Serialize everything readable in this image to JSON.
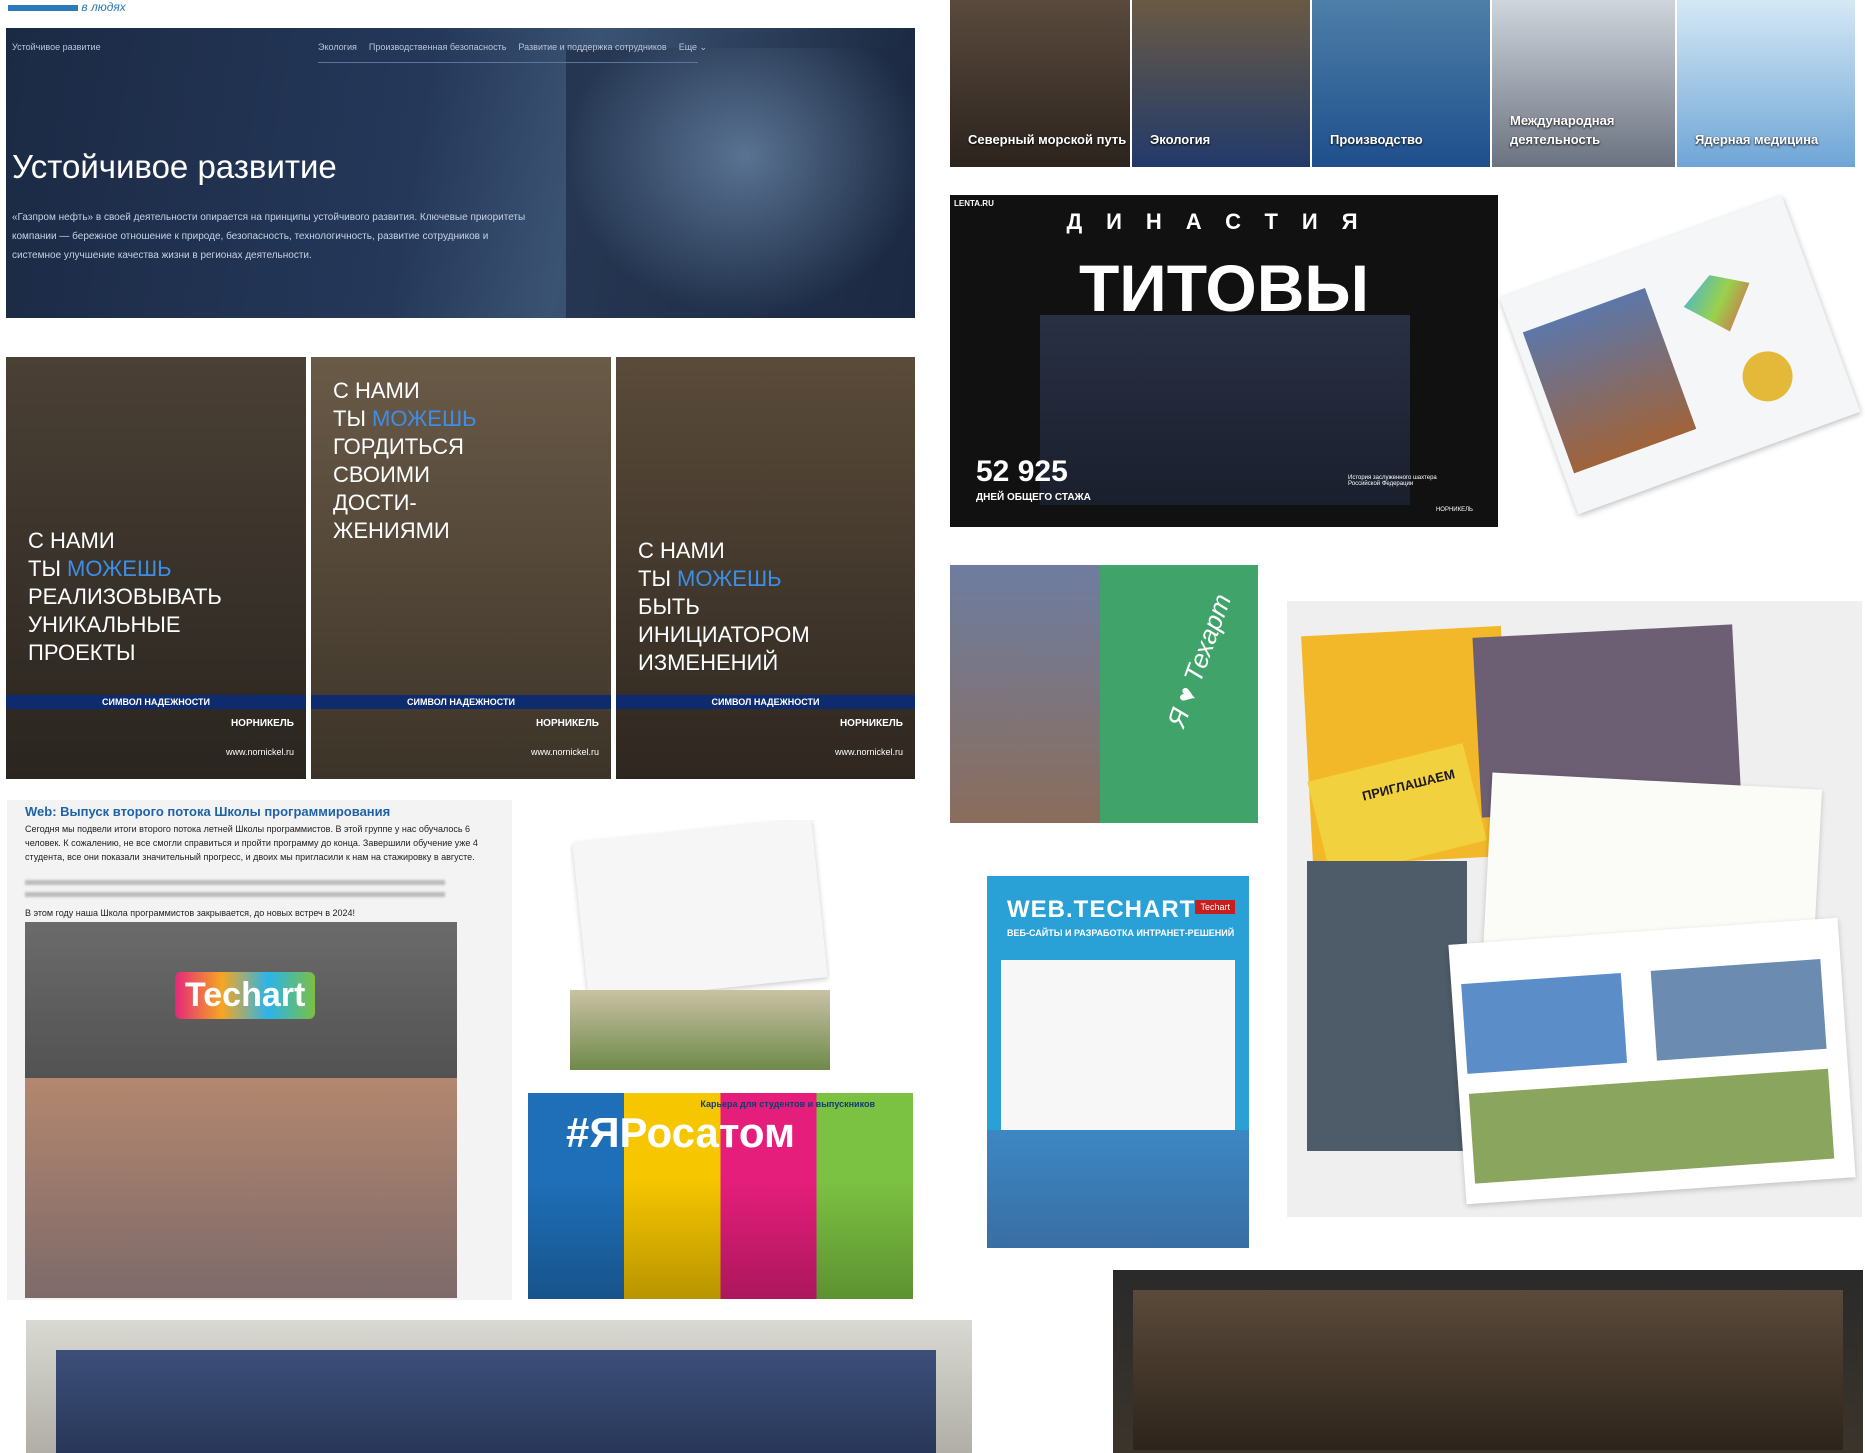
{
  "top_logo": {
    "text": "в людях"
  },
  "gazprom": {
    "nav_left": "Устойчивое развитие",
    "nav_items": [
      "Экология",
      "Производственная безопасность",
      "Развитие и поддержка сотрудников",
      "Еще"
    ],
    "title": "Устойчивое развитие",
    "body": "«Газпром нефть» в своей деятельности опирается на принципы устойчивого развития. Ключевые приоритеты компании — бережное отношение к природе, безопасность, технологичность, развитие сотрудников и системное улучшение качества жизни в регионах деятельности."
  },
  "categories": [
    {
      "label": "Северный морской путь"
    },
    {
      "label": "Экология"
    },
    {
      "label": "Производство"
    },
    {
      "label": "Международная деятельность"
    },
    {
      "label": "Ядерная медицина"
    }
  ],
  "nornickel": [
    {
      "line1": "С НАМИ",
      "line2a": "ТЫ ",
      "line2b": "МОЖЕШЬ",
      "rest": "РЕАЛИЗОВЫВАТЬ УНИКАЛЬНЫЕ ПРОЕКТЫ",
      "symbol": "СИМВОЛ НАДЕЖНОСТИ",
      "brand": "НОРНИКЕЛЬ",
      "site": "www.nornickel.ru"
    },
    {
      "line1": "С НАМИ",
      "line2a": "ТЫ ",
      "line2b": "МОЖЕШЬ",
      "rest": "ГОРДИТЬСЯ СВОИМИ ДОСТИ- ЖЕНИЯМИ",
      "symbol": "СИМВОЛ НАДЕЖНОСТИ",
      "brand": "НОРНИКЕЛЬ",
      "site": "www.nornickel.ru"
    },
    {
      "line1": "С НАМИ",
      "line2a": "ТЫ ",
      "line2b": "МОЖЕШЬ",
      "rest": "БЫТЬ ИНИЦИАТОРОМ ИЗМЕНЕНИЙ",
      "symbol": "СИМВОЛ НАДЕЖНОСТИ",
      "brand": "НОРНИКЕЛЬ",
      "site": "www.nornickel.ru"
    }
  ],
  "titov": {
    "source": "LENTA.RU",
    "dynasty": "ДИНАСТИЯ",
    "name": "ТИТОВЫ",
    "number": "52 925",
    "number_label": "ДНЕЙ ОБЩЕГО СТАЖА",
    "caption": "История заслуженного шахтера Российской Федерации",
    "signature": "НОРНИКЕЛЬ"
  },
  "post": {
    "title": "Web: Выпуск второго потока Школы программирования",
    "text": "Сегодня мы подвели итоги второго потока летней Школы программистов. В этой группе у нас обучалось 6 человек. К сожалению, не все смогли справиться и пройти программу до конца. Завершили обучение уже 4 студента, все они показали значительный прогресс, и двоих мы пригласили к нам на стажировку в августе.",
    "closing": "В этом году наша Школа программистов закрывается, до новых встреч в 2024!",
    "logo": "Techart"
  },
  "rosatom": {
    "top": "Карьера для студентов и выпускников",
    "tag": "#ЯРосатом"
  },
  "techart_book": {
    "text": "Я ♥ Техарт"
  },
  "web_techart": {
    "title": "WEB.TECHART",
    "subtitle": "ВЕБ-САЙТЫ И РАЗРАБОТКА ИНТРАНЕТ-РЕШЕНИЙ",
    "badge": "Techart"
  },
  "invite": {
    "text": "ПРИГЛАШАЕМ"
  }
}
